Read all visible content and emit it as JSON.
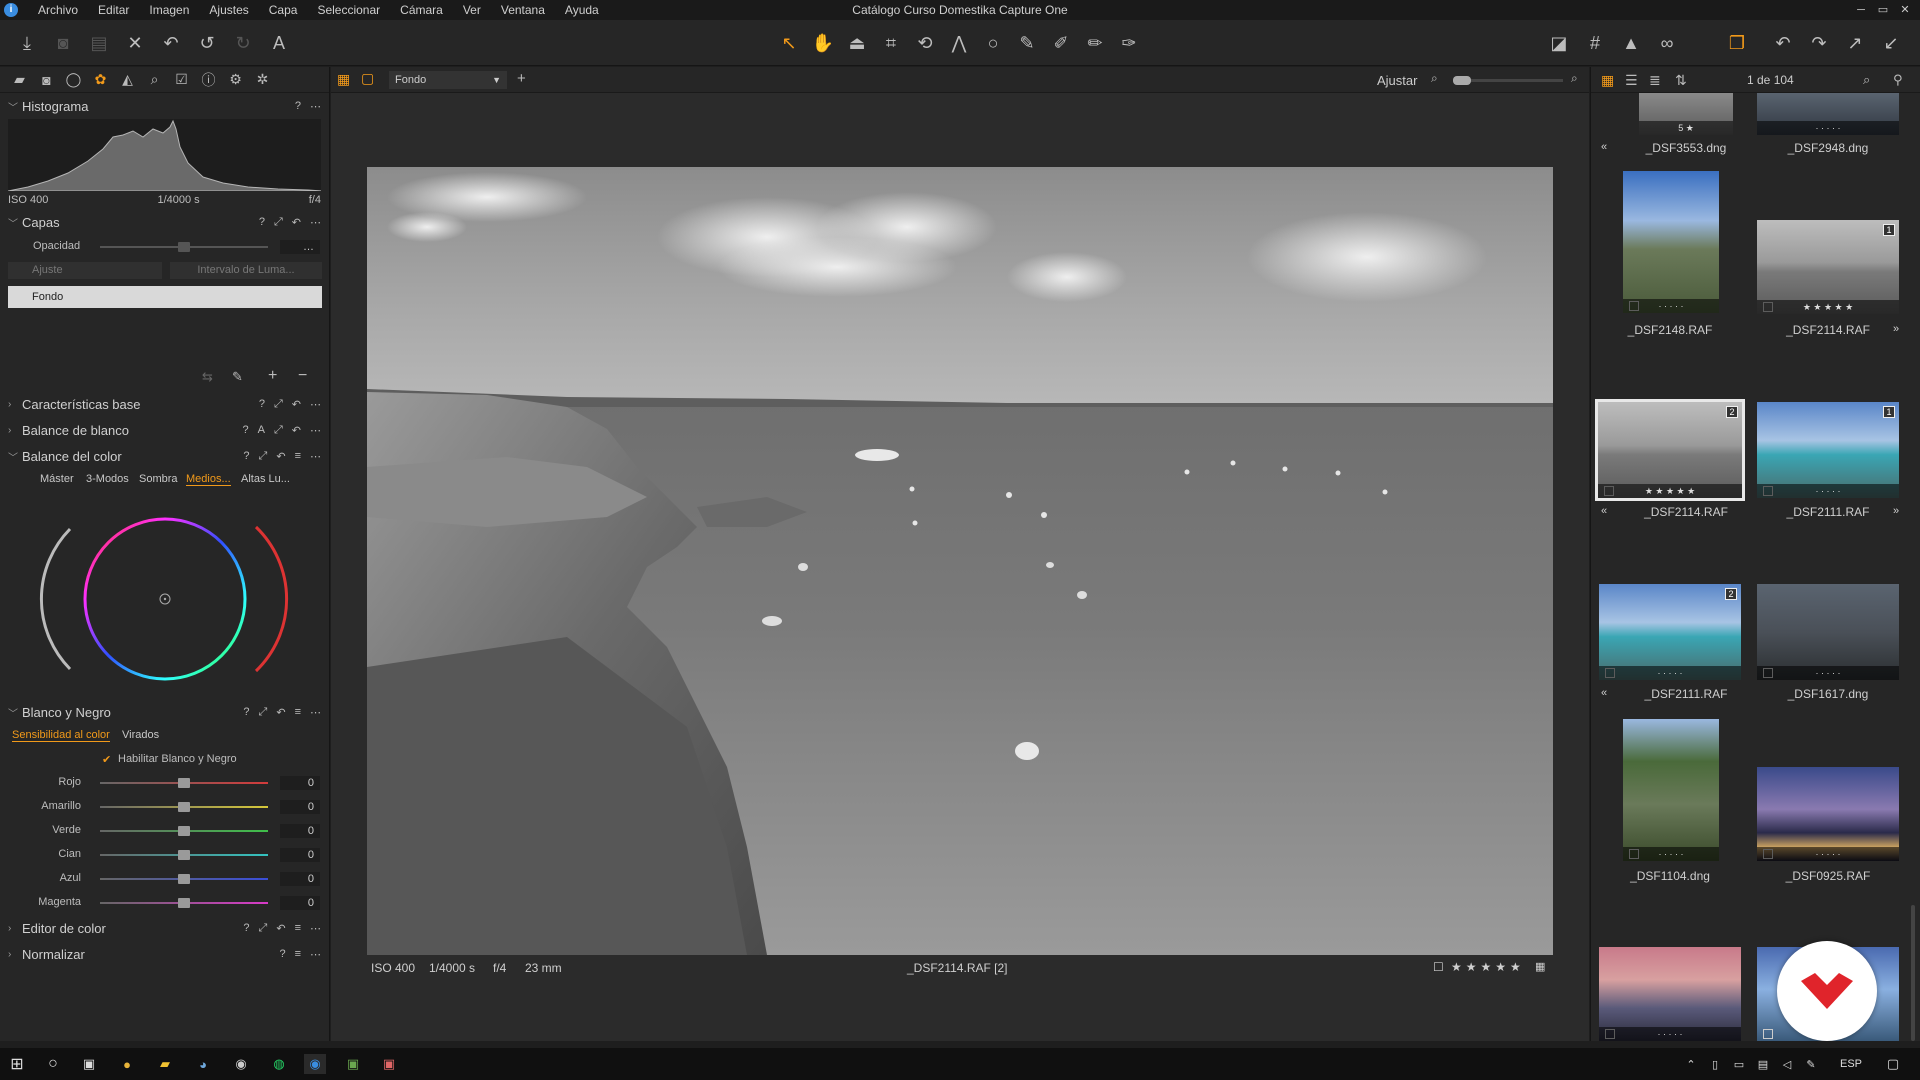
{
  "menubar": {
    "items": [
      "Archivo",
      "Editar",
      "Imagen",
      "Ajustes",
      "Capa",
      "Seleccionar",
      "Cámara",
      "Ver",
      "Ventana",
      "Ayuda"
    ],
    "window_title": "Catálogo Curso Domestika Capture One",
    "app_icon": "i"
  },
  "left_panel": {
    "histogram": {
      "title": "Histograma",
      "iso": "ISO 400",
      "shutter": "1/4000 s",
      "aperture": "f/4"
    },
    "layers": {
      "title": "Capas",
      "opacity_label": "Opacidad",
      "adjust_placeholder": "Ajuste",
      "luma_range": "Intervalo de Luma...",
      "layer_name": "Fondo"
    },
    "sections_collapsed_top": [
      "Características base",
      "Balance de blanco"
    ],
    "color_balance": {
      "title": "Balance del color",
      "tabs": [
        "Máster",
        "3-Modos",
        "Sombra",
        "Medios...",
        "Altas Lu..."
      ],
      "active_tab": "Medios..."
    },
    "bw": {
      "title": "Blanco y Negro",
      "tabs": [
        "Sensibilidad al color",
        "Virados"
      ],
      "enable_label": "Habilitar Blanco y Negro",
      "sliders": [
        {
          "label": "Rojo",
          "value": "0",
          "color": "#d23b3b"
        },
        {
          "label": "Amarillo",
          "value": "0",
          "color": "#d6c83a"
        },
        {
          "label": "Verde",
          "value": "0",
          "color": "#3fbf4a"
        },
        {
          "label": "Cian",
          "value": "0",
          "color": "#33c3c0"
        },
        {
          "label": "Azul",
          "value": "0",
          "color": "#3a4ed8"
        },
        {
          "label": "Magenta",
          "value": "0",
          "color": "#d83ac8"
        }
      ]
    },
    "sections_collapsed_bottom": [
      "Editor de color",
      "Normalizar"
    ]
  },
  "viewer": {
    "layer_dropdown": "Fondo",
    "fit_label": "Ajustar",
    "info": {
      "iso": "ISO 400",
      "shutter": "1/4000 s",
      "aperture": "f/4",
      "focal": "23 mm"
    },
    "filename": "_DSF2114.RAF [2]"
  },
  "browser": {
    "count": "1 de 104",
    "thumbnails": [
      {
        "name": "_DSF3553.dng",
        "rating": "5 ★"
      },
      {
        "name": "_DSF2948.dng"
      },
      {
        "name": "_DSF2148.RAF"
      },
      {
        "name": "_DSF2114.RAF",
        "badge": "1"
      },
      {
        "name": "_DSF2114.RAF",
        "badge": "2"
      },
      {
        "name": "_DSF2111.RAF",
        "badge": "1"
      },
      {
        "name": "_DSF2111.RAF",
        "badge": "2"
      },
      {
        "name": "_DSF1617.dng"
      },
      {
        "name": "_DSF1104.dng"
      },
      {
        "name": "_DSF0925.RAF"
      }
    ]
  },
  "taskbar": {
    "language": "ESP"
  }
}
